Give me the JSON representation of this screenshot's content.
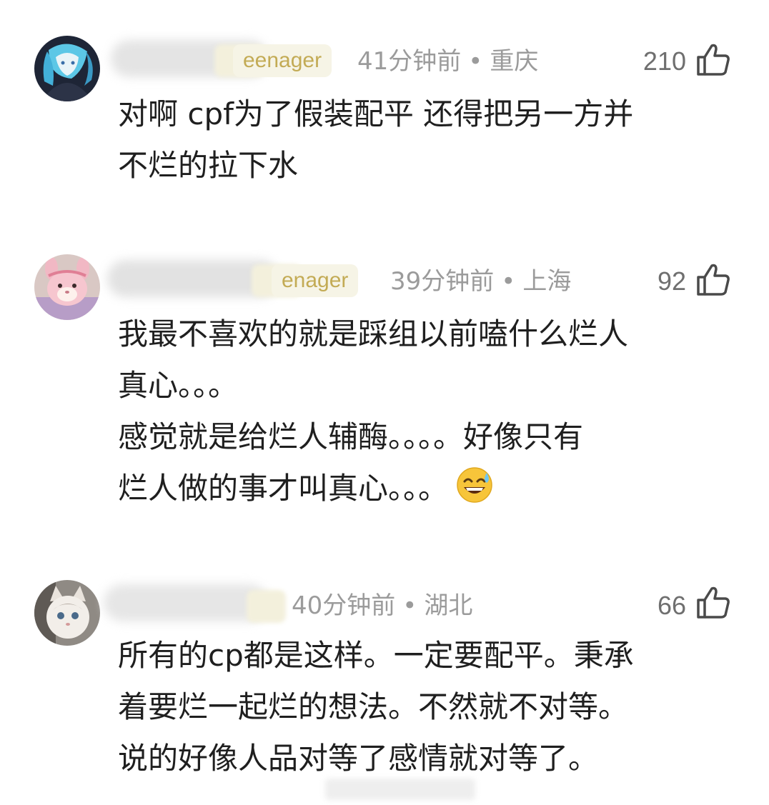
{
  "comments": [
    {
      "badge": "eenager",
      "time": "41分钟前",
      "location": "重庆",
      "likes": "210",
      "lines": [
        "对啊 cpf为了假装配平 还得把另一方并",
        "不烂的拉下水"
      ]
    },
    {
      "badge": "enager",
      "time": "39分钟前",
      "location": "上海",
      "likes": "92",
      "lines": [
        "我最不喜欢的就是踩组以前嗑什么烂人",
        "真心。。。",
        "感觉就是给烂人辅酶。。。。好像只有",
        "烂人做的事才叫真心。。。"
      ],
      "emoji": "sweat-smile-emoji"
    },
    {
      "badge": "",
      "time": "40分钟前",
      "location": "湖北",
      "likes": "66",
      "lines": [
        "所有的cp都是这样。一定要配平。秉承",
        "着要烂一起烂的想法。不然就不对等。",
        "说的好像人品对等了感情就对等了。"
      ]
    }
  ],
  "separator": "•",
  "colors": {
    "meta": "#9b9b9b",
    "badge_text": "#c3ab55",
    "badge_bg": "#f6f4e6",
    "body_text": "#1f1f1f",
    "like_count": "#6f6f6f"
  }
}
